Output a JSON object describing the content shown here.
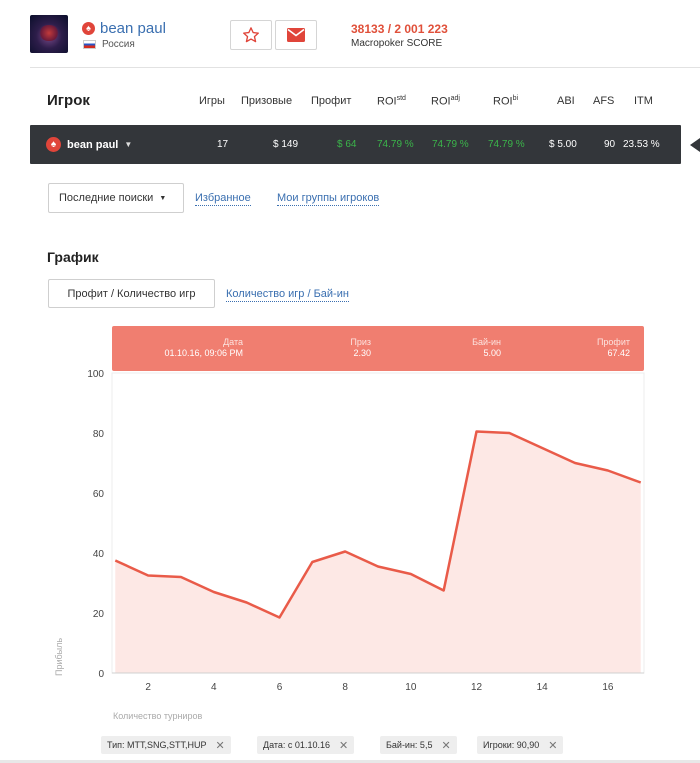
{
  "header": {
    "username": "bean paul",
    "country": "Россия",
    "favorite_icon": "star-icon",
    "message_icon": "envelope-icon",
    "score_value": "38133 / 2 001 223",
    "score_label": "Macropoker SCORE"
  },
  "stats": {
    "title": "Игрок",
    "columns": [
      "Игры",
      "Призовые",
      "Профит",
      "ROI",
      "ROI",
      "ROI",
      "ABI",
      "AFS",
      "ITM"
    ],
    "roi_suffixes": [
      "std",
      "adj",
      "bi"
    ],
    "row": {
      "player": "bean paul",
      "values": [
        "17",
        "$ 149",
        "$ 64",
        "74.79 %",
        "74.79 %",
        "74.79 %",
        "$ 5.00",
        "90",
        "23.53 %"
      ]
    },
    "colors": {
      "bar_bg": "#33363a",
      "positive": "#3bb54a"
    }
  },
  "search": {
    "dropdown_label": "Последние поиски",
    "links": [
      "Избранное",
      "Мои группы игроков"
    ]
  },
  "graph": {
    "title": "График",
    "toggle_active": "Профит / Количество игр",
    "toggle_other": "Количество игр / Бай-ин",
    "tooltip": {
      "date_label": "Дата",
      "date_value": "01.10.16, 09:06 PM",
      "prize_label": "Приз",
      "prize_value": "2.30",
      "buyin_label": "Бай-ин",
      "buyin_value": "5.00",
      "profit_label": "Профит",
      "profit_value": "67.42"
    }
  },
  "chart_data": {
    "type": "area",
    "x": [
      1,
      2,
      3,
      4,
      5,
      6,
      7,
      8,
      9,
      10,
      11,
      12,
      13,
      14,
      15,
      16,
      17
    ],
    "values": [
      37.5,
      32.5,
      32,
      27,
      23.5,
      18.5,
      37,
      40.5,
      35.5,
      33,
      27.5,
      80.5,
      80,
      75,
      70,
      67.5,
      63.5
    ],
    "xticks": [
      2,
      4,
      6,
      8,
      10,
      12,
      14,
      16
    ],
    "yticks": [
      0,
      20,
      40,
      60,
      80,
      100
    ],
    "ylim": [
      0,
      100
    ],
    "xlim": [
      0.9,
      17.1
    ],
    "xlabel": "Количество турниров",
    "ylabel": "Прибыль",
    "line_color": "#e95b49",
    "fill_color": "#fde8e5",
    "grid": false
  },
  "filters": [
    "Тип: MTT,SNG,STT,HUP",
    "Дата: с 01.10.16",
    "Бай-ин: 5,5",
    "Игроки: 90,90"
  ]
}
